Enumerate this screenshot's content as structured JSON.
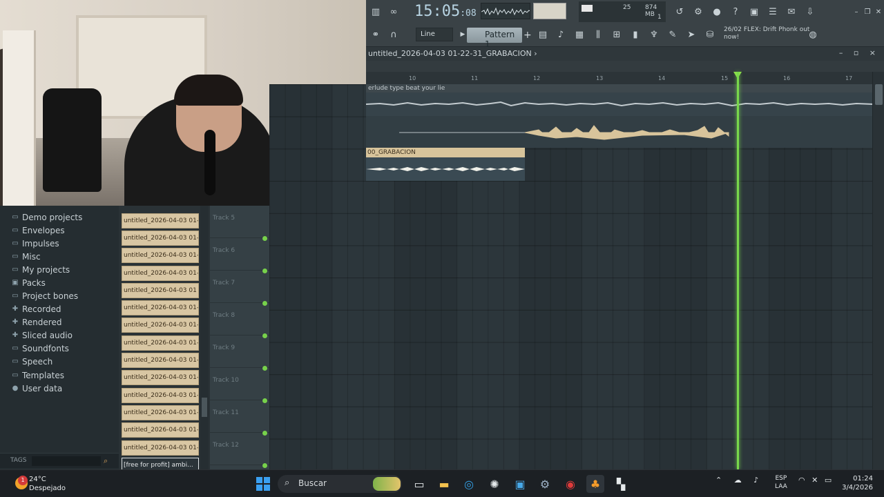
{
  "toolbar": {
    "time_main": "15:05",
    "time_small": ":08",
    "cpu_value": "25",
    "memory": "874 MB",
    "voices": "1",
    "snap": "Line",
    "pattern": "Pattern 1",
    "pattern_add": "+",
    "news_date": "26/02",
    "news_text": "FLEX: Drift Phonk out now!"
  },
  "playlist": {
    "title": "untitled_2026-04-03 01-22-31_GRABACION",
    "title_arrow": "›",
    "window_buttons": "– ▫ ×",
    "ruler": [
      "10",
      "11",
      "12",
      "13",
      "14",
      "15",
      "16",
      "17"
    ],
    "clip1_label": "erlude type beat your lie",
    "clip3_label": "00_GRABACION"
  },
  "browser": {
    "items": [
      {
        "label": "Demo projects",
        "icon": "folder-icon"
      },
      {
        "label": "Envelopes",
        "icon": "folder-icon"
      },
      {
        "label": "Impulses",
        "icon": "folder-icon"
      },
      {
        "label": "Misc",
        "icon": "folder-icon"
      },
      {
        "label": "My projects",
        "icon": "folder-icon"
      },
      {
        "label": "Packs",
        "icon": "packs-icon"
      },
      {
        "label": "Project bones",
        "icon": "folder-icon"
      },
      {
        "label": "Recorded",
        "icon": "plus-icon"
      },
      {
        "label": "Rendered",
        "icon": "plus-icon"
      },
      {
        "label": "Sliced audio",
        "icon": "plus-icon"
      },
      {
        "label": "Soundfonts",
        "icon": "folder-icon"
      },
      {
        "label": "Speech",
        "icon": "folder-icon"
      },
      {
        "label": "Templates",
        "icon": "folder-icon"
      },
      {
        "label": "User data",
        "icon": "user-icon"
      }
    ],
    "tags_label": "TAGS"
  },
  "picker": {
    "clips": [
      "untitled_2026-04-03 01-",
      "untitled_2026-04-03 01-",
      "untitled_2026-04-03 01-",
      "untitled_2026-04-03 01-",
      "untitled_2026-04-03 01",
      "untitled_2026-04-03 01-",
      "untitled_2026-04-03 01-",
      "untitled_2026-04-03 01-",
      "untitled_2026-04-03 01-",
      "untitled_2026-04-03 01-",
      "untitled_2026-04-03 01-",
      "untitled_2026-04-03 01-",
      "untitled_2026-04-03 01-",
      "untitled_2026-04-03 01-"
    ],
    "selected": "[free for profit] ambi..."
  },
  "tracks": [
    "Track 5",
    "Track 6",
    "Track 7",
    "Track 8",
    "Track 9",
    "Track 10",
    "Track 11",
    "Track 12"
  ],
  "taskbar": {
    "temp": "24°C",
    "weather": "Despejado",
    "weather_badge": "1",
    "search": "Buscar",
    "lang1": "ESP",
    "lang2": "LAA",
    "time": "01:24",
    "date": "3/4/2026"
  },
  "colors": {
    "playhead": "#79d84c",
    "clip_fill": "#d8c49b",
    "accent_blue": "#3aa0f2"
  }
}
